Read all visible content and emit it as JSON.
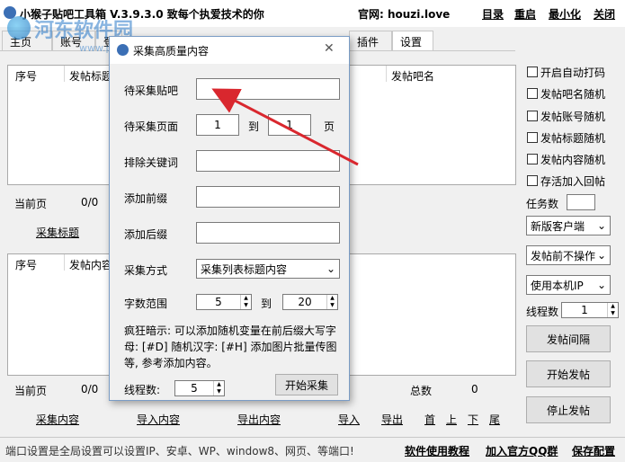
{
  "app": {
    "title": "小猴子贴吧工具箱 V.3.9.3.0 致每个执爱技术的你",
    "site_label": "官网: houzi.love",
    "menu": [
      "目录",
      "重启",
      "最小化",
      "关闭"
    ]
  },
  "watermark": {
    "main": "河东软件园",
    "url": "www.pc0359.cn"
  },
  "tabs": [
    "主页",
    "账号",
    "登",
    "插件",
    "设置"
  ],
  "top_table": {
    "headers": [
      "序号",
      "发帖标题",
      "发帖吧名"
    ],
    "page_label": "当前页",
    "page_value": "0/0",
    "collect_link": "采集标题"
  },
  "bottom_table": {
    "headers": [
      "序号",
      "发帖内容"
    ],
    "page_label": "当前页",
    "page_value": "0/0",
    "total_label": "总数",
    "total_value": "0",
    "links": [
      "采集内容",
      "导入内容",
      "导出内容",
      "导入",
      "导出",
      "首",
      "上",
      "下",
      "尾"
    ]
  },
  "right_panel": {
    "checkboxes": [
      "开启自动打码",
      "发帖吧名随机",
      "发帖账号随机",
      "发帖标题随机",
      "发帖内容随机",
      "存活加入回帖"
    ],
    "task_count_label": "任务数",
    "task_count_value": "",
    "client_select": "新版客户端",
    "pre_post_select": "发帖前不操作",
    "ip_select": "使用本机IP",
    "threads_label": "线程数",
    "threads_value": "1",
    "interval_button": "发帖间隔",
    "start_button": "开始发帖",
    "stop_button": "停止发帖"
  },
  "status_bar": {
    "message": "端口设置是全局设置可以设置IP、安卓、WP、window8、网页、等端口!",
    "links": [
      "软件使用教程",
      "加入官方QQ群",
      "保存配置"
    ]
  },
  "dialog": {
    "title": "采集高质量内容",
    "close_glyph": "✕",
    "target_bar_label": "待采集贴吧",
    "target_bar_value": "",
    "pages_label": "待采集页面",
    "page_from": "1",
    "page_to_label": "到",
    "page_to": "1",
    "page_unit": "页",
    "exclude_label": "排除关键词",
    "prefix_label": "添加前缀",
    "suffix_label": "添加后缀",
    "method_label": "采集方式",
    "method_value": "采集列表标题内容",
    "length_label": "字数范围",
    "length_min": "5",
    "length_to_label": "到",
    "length_max": "20",
    "hint": "疯狂暗示: 可以添加随机变量在前后缀大写字母: [#D] 随机汉字: [#H] 添加图片批量传图等, 参考添加内容。",
    "threads_label": "线程数:",
    "threads_value": "5",
    "start_button": "开始采集"
  },
  "colors": {
    "arrow": "#d9272e",
    "accent": "#3b6fb5"
  }
}
